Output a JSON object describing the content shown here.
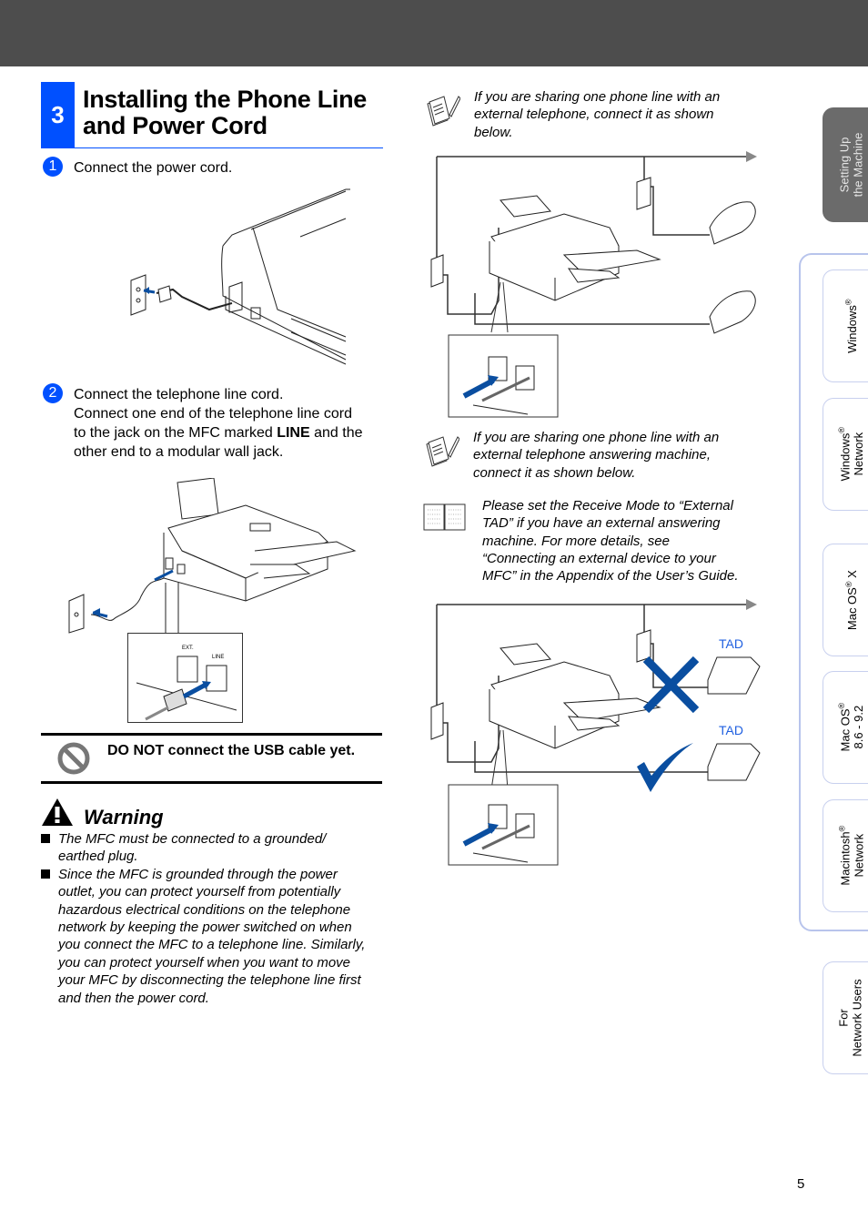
{
  "section": {
    "number": "3",
    "title_line1": "Installing the Phone Line",
    "title_line2": "and Power Cord"
  },
  "steps": [
    {
      "badge": "1",
      "text": "Connect the power cord."
    },
    {
      "badge": "2",
      "line1": "Connect the telephone line cord.",
      "line2": "Connect one end of the telephone line cord",
      "line3_pre": "to the jack on the MFC marked ",
      "line3_bold": "LINE",
      "line3_post": " and the",
      "line4": "other end to a modular wall jack."
    }
  ],
  "jack_labels": {
    "ext": "EXT.",
    "line": "LINE"
  },
  "caution": {
    "icon": "prohibited-icon",
    "text": "DO NOT connect the USB cable yet."
  },
  "warning": {
    "icon": "warning-triangle-icon",
    "title": "Warning",
    "items": [
      [
        "The MFC must be connected to a grounded/",
        "earthed plug."
      ],
      [
        "Since the MFC is grounded through the power",
        "outlet, you can protect yourself from potentially",
        "hazardous electrical conditions on the telephone",
        "network by keeping the power switched on when",
        "you connect the MFC to a telephone line. Similarly,",
        "you can protect yourself when you want to move",
        "your MFC by disconnecting the telephone line first",
        "and then the power cord."
      ]
    ]
  },
  "notes": [
    {
      "icon": "note-pencil-icon",
      "lines": [
        "If you are sharing one phone line with an",
        "external telephone, connect it as shown",
        "below."
      ]
    },
    {
      "icon": "note-pencil-icon",
      "lines": [
        "If you are sharing one phone line with an",
        "external telephone answering machine,",
        "connect it as shown below."
      ]
    },
    {
      "icon": "book-icon",
      "lines": [
        "Please set the Receive Mode to “External",
        "TAD” if you have an external answering",
        "machine. For more details, see",
        "“Connecting an external device to your",
        "MFC” in the Appendix of the User’s Guide."
      ]
    }
  ],
  "diagram_labels": {
    "tad_top": "TAD",
    "tad_bottom": "TAD"
  },
  "tabs": [
    {
      "line1": "Setting Up",
      "line2": "the Machine",
      "active": true
    },
    {
      "line1": "Windows",
      "sup": "®",
      "line2": "",
      "active": false
    },
    {
      "line1": "Windows",
      "sup": "®",
      "line2": "Network",
      "active": false
    },
    {
      "line1": "Mac OS",
      "sup": "®",
      "after": " X",
      "line2": "",
      "active": false
    },
    {
      "line1": "Mac OS",
      "sup": "®",
      "line2": "8.6 - 9.2",
      "active": false
    },
    {
      "line1": "Macintosh",
      "sup": "®",
      "line2": "Network",
      "active": false
    },
    {
      "line1": "For",
      "line2": "Network Users",
      "active": false
    }
  ],
  "colors": {
    "brand_blue": "#0050ff",
    "header_gray": "#4d4d4d",
    "diagram_blue": "#0a4ea0",
    "tad_blue": "#2060e0"
  },
  "page_number": "5"
}
